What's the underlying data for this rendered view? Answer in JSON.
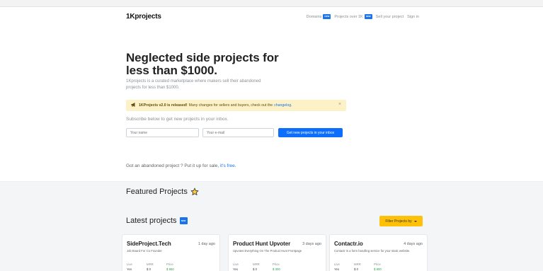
{
  "nav": {
    "brand": "1Kprojects",
    "links": [
      {
        "label": "Domains",
        "badge": "new"
      },
      {
        "label": "Projects over 1K",
        "badge": "new"
      },
      {
        "label": "Sell your project",
        "badge": ""
      },
      {
        "label": "Sign in",
        "badge": ""
      }
    ]
  },
  "hero": {
    "title": "Neglected side projects for less than $1000.",
    "subtitle": "1Kprojects is a curated marketplace where makers sell their abandoned projects for less than $1000."
  },
  "alert": {
    "bold": "1KProjects v2.0 is released!",
    "text": "Many changes for sellers and buyers, check out the",
    "link": "changelog",
    "end": ".",
    "close": "×"
  },
  "subscribe": {
    "label": "Subscribe below to get new projects in your inbox.",
    "name_placeholder": "Your name",
    "email_placeholder": "Your e-mail",
    "button": "Get new projects in your inbox"
  },
  "abandon": {
    "text": "Got an abandoned project ? Put it up for sale,",
    "link": "it's free."
  },
  "featured": {
    "title": "Featured Projects"
  },
  "latest": {
    "title": "Latest projects",
    "badge": "NEW",
    "filter_button": "Filter Projects by"
  },
  "cards": [
    {
      "title": "SideProject.Tech",
      "ago": "1 day ago",
      "desc": "Job Board For Co Founder",
      "stats": [
        {
          "label": "Live",
          "value": "Yes"
        },
        {
          "label": "MRR",
          "value": "$ 0"
        },
        {
          "label": "Price",
          "value": "$ 950"
        }
      ]
    },
    {
      "title": "Product Hunt Upvoter",
      "ago": "3 days ago",
      "desc": "Upvotes Everything On The Product Hunt Frontpage",
      "stats": [
        {
          "label": "Live",
          "value": "Yes"
        },
        {
          "label": "MRR",
          "value": "$ 0"
        },
        {
          "label": "Price",
          "value": "$ 300"
        }
      ]
    },
    {
      "title": "Contactr.io",
      "ago": "4 days ago",
      "desc": "Contactr is a form handling service for your static website.",
      "stats": [
        {
          "label": "Live",
          "value": "Yes"
        },
        {
          "label": "MRR",
          "value": "$ 0"
        },
        {
          "label": "Price",
          "value": "$ 800"
        }
      ]
    }
  ],
  "colors": {
    "primary": "#0d6efd",
    "accent_blue": "#1a73e8",
    "warning": "#ffc107",
    "alert_bg": "#fdf1c7",
    "price_green": "#2ea44f"
  },
  "icons": {
    "star": "star-icon",
    "megaphone": "megaphone-icon",
    "caret": "caret-down-icon"
  }
}
